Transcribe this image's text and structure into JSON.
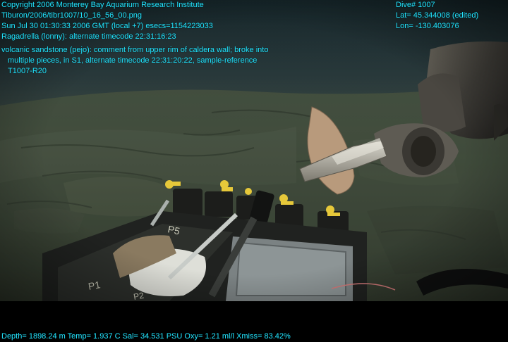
{
  "overlay": {
    "top_left": [
      "Copyright 2006 Monterey Bay Aquarium Research Institute",
      "Tiburon/2006/tibr1007/10_16_56_00.png",
      "Sun Jul 30 01:30:33 2006 GMT (local +7)  esecs=1154223033",
      "Ragadrella (lonny): alternate timecode 22:31:16:23"
    ],
    "top_right": [
      "Dive# 1007",
      "Lat= 45.344008 (edited)",
      "Lon= -130.403076"
    ],
    "annotation": [
      "volcanic sandstone (pejo): comment from upper rim of caldera wall; broke into",
      "multiple pieces, in S1, alternate timecode 22:31:20:22, sample-reference",
      "T1007-R20"
    ],
    "footer": "Depth= 1898.24 m  Temp= 1.937 C  Sal= 34.531 PSU  Oxy= 1.21 ml/l  Xmiss= 83.42%"
  },
  "scene_labels": {
    "crate_label": "P1",
    "sediment_box_label": "P5",
    "sediment_box_label_2": "P2"
  },
  "colors": {
    "overlay_text": "#22e6ff",
    "seafloor": "#3f4a3a",
    "water": "#1b2a2e"
  }
}
